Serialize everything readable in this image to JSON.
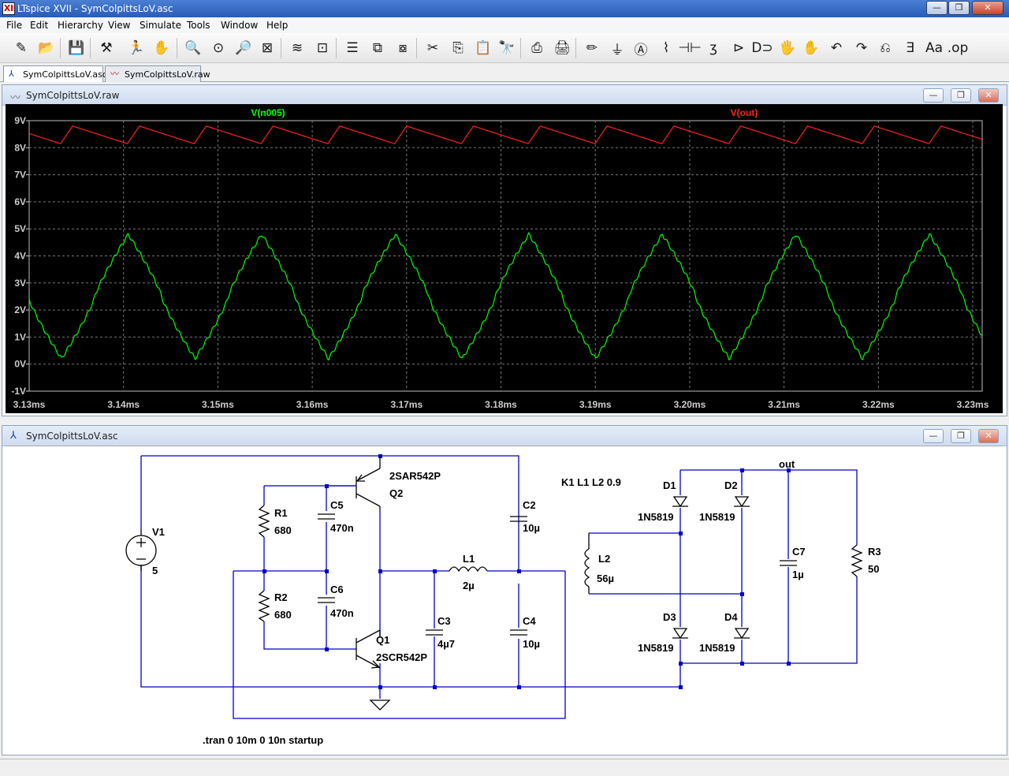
{
  "window": {
    "title": "LTspice XVII - SymColpittsLoV.asc",
    "icon": "ltspice-icon"
  },
  "window_controls": {
    "minimize": "—",
    "maximize": "❐",
    "close": "✕"
  },
  "menu": [
    {
      "label": "File",
      "accel": "F"
    },
    {
      "label": "Edit",
      "accel": "E"
    },
    {
      "label": "Hierarchy",
      "accel": "i"
    },
    {
      "label": "View",
      "accel": "V"
    },
    {
      "label": "Simulate",
      "accel": "S"
    },
    {
      "label": "Tools",
      "accel": "T"
    },
    {
      "label": "Window",
      "accel": "W"
    },
    {
      "label": "Help",
      "accel": "H"
    }
  ],
  "toolbar": [
    {
      "icon": "new-schematic-icon",
      "glyph": "✎"
    },
    {
      "icon": "open-icon",
      "glyph": "📂"
    },
    {
      "icon": "save-icon",
      "glyph": "💾"
    },
    {
      "icon": "control-panel-icon",
      "glyph": "⚒"
    },
    {
      "icon": "run-icon",
      "glyph": "🏃"
    },
    {
      "icon": "halt-icon",
      "glyph": "✋"
    },
    {
      "icon": "zoom-in-icon",
      "glyph": "🔍"
    },
    {
      "icon": "pan-icon",
      "glyph": "⊙"
    },
    {
      "icon": "zoom-out-icon",
      "glyph": "🔎"
    },
    {
      "icon": "zoom-fit-icon",
      "glyph": "⊠"
    },
    {
      "icon": "autorange-icon",
      "glyph": "≋"
    },
    {
      "icon": "pick-visible-traces-icon",
      "glyph": "⊡"
    },
    {
      "icon": "tile-horizontal-icon",
      "glyph": "☰"
    },
    {
      "icon": "cascade-icon",
      "glyph": "⧉"
    },
    {
      "icon": "tile-vertical-icon",
      "glyph": "⧇"
    },
    {
      "icon": "cut-icon",
      "glyph": "✂"
    },
    {
      "icon": "copy-icon",
      "glyph": "⎘"
    },
    {
      "icon": "paste-icon",
      "glyph": "📋"
    },
    {
      "icon": "find-icon",
      "glyph": "🔭"
    },
    {
      "icon": "print-icon",
      "glyph": "⎙"
    },
    {
      "icon": "print-setup-icon",
      "glyph": "🖨"
    },
    {
      "icon": "draw-wire-icon",
      "glyph": "✏"
    },
    {
      "icon": "ground-icon",
      "glyph": "⏚"
    },
    {
      "icon": "label-net-icon",
      "glyph": "Ⓐ"
    },
    {
      "icon": "resistor-icon",
      "glyph": "⌇"
    },
    {
      "icon": "capacitor-icon",
      "glyph": "⊣⊢"
    },
    {
      "icon": "inductor-icon",
      "glyph": "ʒ"
    },
    {
      "icon": "diode-icon",
      "glyph": "⊳"
    },
    {
      "icon": "component-icon",
      "glyph": "D⊃"
    },
    {
      "icon": "move-icon",
      "glyph": "🖐"
    },
    {
      "icon": "drag-icon",
      "glyph": "✋"
    },
    {
      "icon": "undo-icon",
      "glyph": "↶"
    },
    {
      "icon": "redo-icon",
      "glyph": "↷"
    },
    {
      "icon": "rotate-icon",
      "glyph": "⎌"
    },
    {
      "icon": "mirror-icon",
      "glyph": "Ǝ"
    },
    {
      "icon": "text-icon",
      "glyph": "Aa"
    },
    {
      "icon": "spice-directive-icon",
      "glyph": ".op"
    }
  ],
  "tabs": [
    {
      "label": "SymColpittsLoV.asc",
      "icon": "schematic-icon",
      "active": true
    },
    {
      "label": "SymColpittsLoV.raw",
      "icon": "waveform-icon",
      "active": false
    }
  ],
  "waveform_window": {
    "title": "SymColpittsLoV.raw",
    "controls": {
      "minimize": "—",
      "maximize": "❐",
      "close": "✕"
    }
  },
  "schematic_window": {
    "title": "SymColpittsLoV.asc",
    "controls": {
      "minimize": "—",
      "maximize": "❐",
      "close": "✕"
    }
  },
  "chart_data": {
    "type": "line",
    "background": "#000000",
    "grid": true,
    "xlim": [
      3.13,
      3.231
    ],
    "ylim": [
      -1,
      9
    ],
    "x_ticks": [
      "3.13ms",
      "3.14ms",
      "3.15ms",
      "3.16ms",
      "3.17ms",
      "3.18ms",
      "3.19ms",
      "3.20ms",
      "3.21ms",
      "3.22ms",
      "3.23ms"
    ],
    "y_ticks": [
      "9V",
      "8V",
      "7V",
      "6V",
      "5V",
      "4V",
      "3V",
      "2V",
      "1V",
      "0V",
      "-1V"
    ],
    "series": [
      {
        "name": "V(n005)",
        "color": "#00ff00",
        "period": 0.01415,
        "min": 0.2,
        "max": 4.8,
        "first_peak": 3.1405
      },
      {
        "name": "V(out)",
        "color": "#ff2020",
        "period": 0.00708,
        "min": 8.15,
        "max": 8.8,
        "first_peak": 3.1346
      }
    ]
  },
  "schematic": {
    "components": [
      {
        "ref": "V1",
        "value": "5"
      },
      {
        "ref": "R1",
        "value": "680"
      },
      {
        "ref": "R2",
        "value": "680"
      },
      {
        "ref": "C5",
        "value": "470n"
      },
      {
        "ref": "C6",
        "value": "470n"
      },
      {
        "ref": "Q2",
        "value": "2SAR542P"
      },
      {
        "ref": "Q1",
        "value": "2SCR542P"
      },
      {
        "ref": "C2",
        "value": "10µ"
      },
      {
        "ref": "C3",
        "value": "4µ7"
      },
      {
        "ref": "C4",
        "value": "10µ"
      },
      {
        "ref": "L1",
        "value": "2µ"
      },
      {
        "ref": "L2",
        "value": "56µ"
      },
      {
        "ref": "D1",
        "value": "1N5819"
      },
      {
        "ref": "D2",
        "value": "1N5819"
      },
      {
        "ref": "D3",
        "value": "1N5819"
      },
      {
        "ref": "D4",
        "value": "1N5819"
      },
      {
        "ref": "C7",
        "value": "1µ"
      },
      {
        "ref": "R3",
        "value": "50"
      }
    ],
    "coupling": "K1 L1 L2 0.9",
    "net_label": "out",
    "directive": ".tran 0 10m 0 10n startup",
    "wire_color": "#0000c8",
    "component_color": "#000000"
  }
}
